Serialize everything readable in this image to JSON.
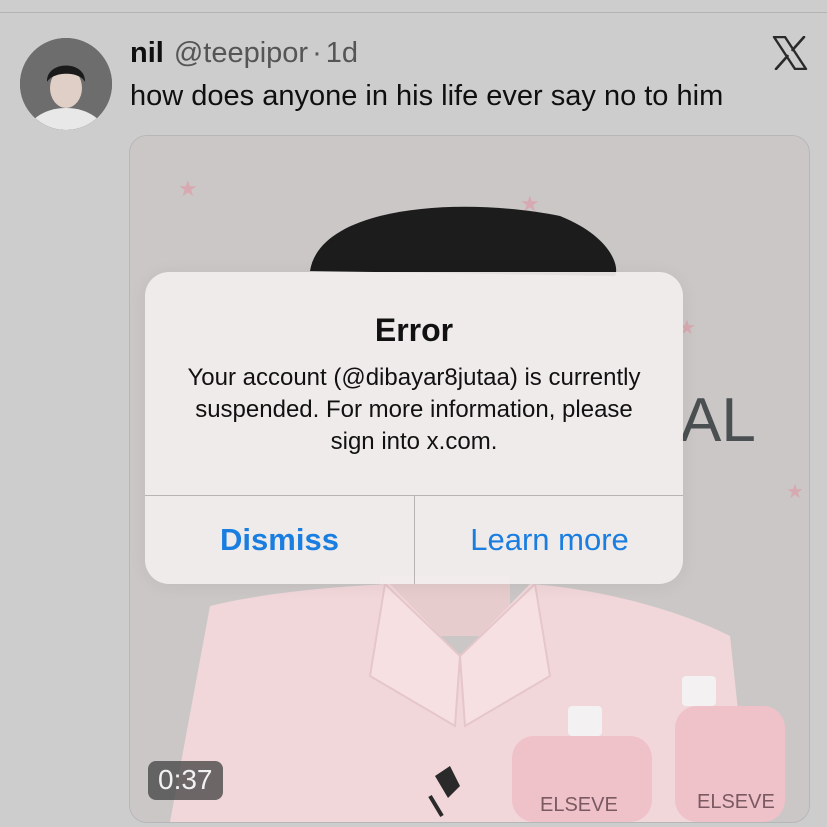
{
  "tweet": {
    "author_name": "nil",
    "handle": "@teepipor",
    "separator": "·",
    "time": "1d",
    "text": "how does anyone in his life ever say no to him"
  },
  "media": {
    "duration": "0:37",
    "background_letters": "AL",
    "bottle_labels": [
      "ELSEVE",
      "ELSEVE"
    ]
  },
  "alert": {
    "title": "Error",
    "message": "Your account (@dibayar8jutaa) is currently suspended. For more information, please sign into x.com.",
    "dismiss_label": "Dismiss",
    "learn_more_label": "Learn more"
  },
  "icons": {
    "brand": "x-logo-icon"
  },
  "colors": {
    "accent": "#1a7ee0",
    "background": "#cdcdcd"
  }
}
